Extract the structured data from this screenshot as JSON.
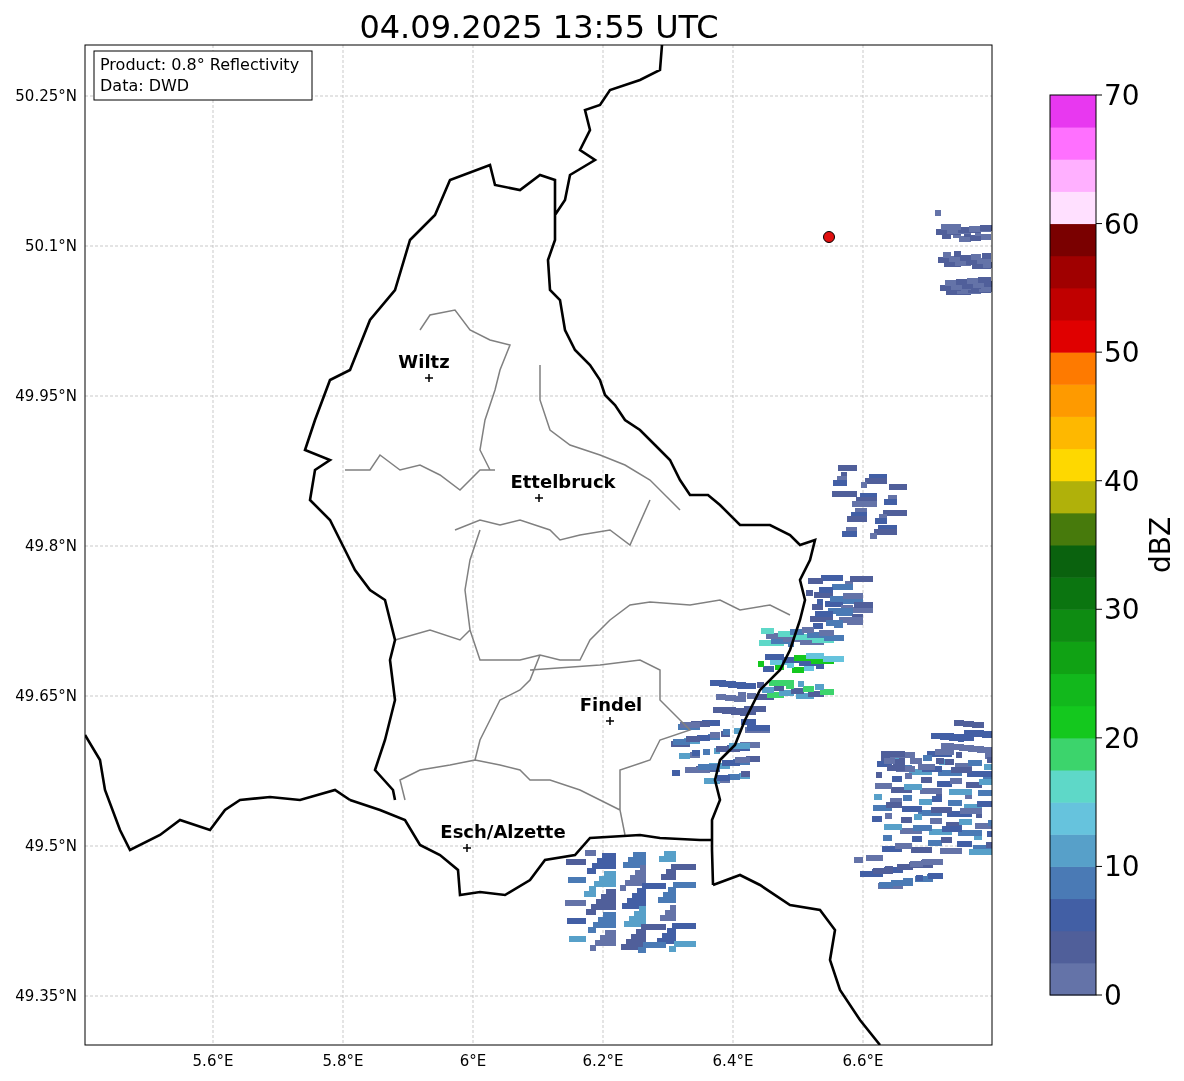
{
  "title": "04.09.2025 13:55 UTC",
  "info_box": [
    "Product: 0.8° Reflectivity",
    "Data: DWD"
  ],
  "lat_ticks": [
    "50.25°N",
    "50.1°N",
    "49.95°N",
    "49.8°N",
    "49.65°N",
    "49.5°N",
    "49.35°N"
  ],
  "lon_ticks": [
    "5.6°E",
    "5.8°E",
    "6°E",
    "6.2°E",
    "6.4°E",
    "6.6°E"
  ],
  "cities": [
    {
      "name": "Wiltz"
    },
    {
      "name": "Ettelbruck"
    },
    {
      "name": "Findel"
    },
    {
      "name": "Esch/Alzette"
    }
  ],
  "colorbar": {
    "label": "dBZ",
    "ticks": [
      "70",
      "60",
      "50",
      "40",
      "30",
      "20",
      "10",
      "0"
    ],
    "bins": [
      {
        "color": "#6473a8"
      },
      {
        "color": "#505f9a"
      },
      {
        "color": "#425fa5"
      },
      {
        "color": "#4a7ab5"
      },
      {
        "color": "#57a0c9"
      },
      {
        "color": "#66c3dd"
      },
      {
        "color": "#5ed8c8"
      },
      {
        "color": "#3cd46c"
      },
      {
        "color": "#14c81e"
      },
      {
        "color": "#12b81c"
      },
      {
        "color": "#10a214"
      },
      {
        "color": "#0e8c12"
      },
      {
        "color": "#0b7510"
      },
      {
        "color": "#0a620e"
      },
      {
        "color": "#477a0c"
      },
      {
        "color": "#b0b10a"
      },
      {
        "color": "#fed800"
      },
      {
        "color": "#feb800"
      },
      {
        "color": "#fe9a00"
      },
      {
        "color": "#fe7a00"
      },
      {
        "color": "#e00000"
      },
      {
        "color": "#c00000"
      },
      {
        "color": "#a00000"
      },
      {
        "color": "#7a0000"
      },
      {
        "color": "#ffe0ff"
      },
      {
        "color": "#ffb0ff"
      },
      {
        "color": "#ff70ff"
      },
      {
        "color": "#e838f0"
      }
    ]
  }
}
